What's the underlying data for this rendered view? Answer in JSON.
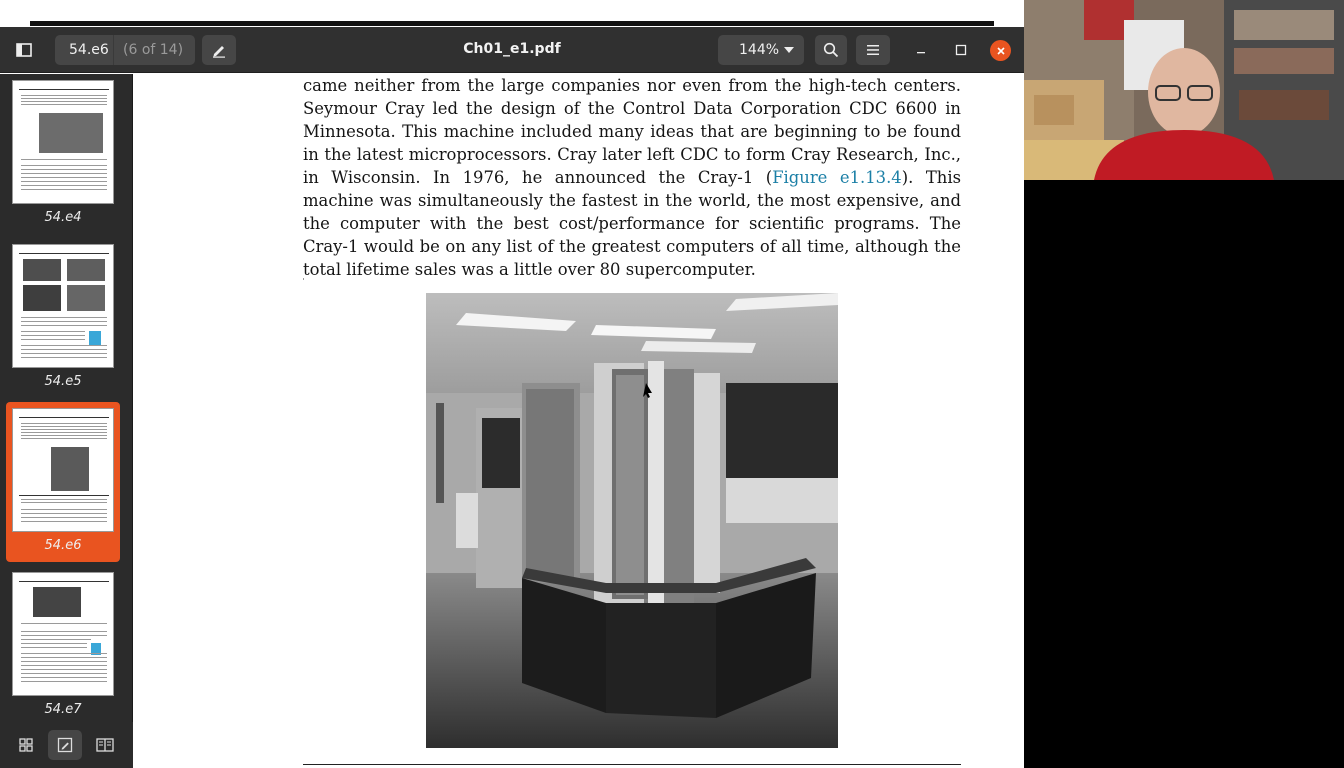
{
  "app": {
    "title": "Ch01_e1.pdf",
    "page_label": "54.e6",
    "page_of": "(6 of 14)",
    "zoom": "144%"
  },
  "icons": {
    "sidebar_toggle": "sidebar-icon",
    "annotate": "pencil-icon",
    "search": "search-icon",
    "menu": "hamburger-menu-icon",
    "minimize": "minimize-icon",
    "maximize": "maximize-icon",
    "close": "close-icon",
    "thumbnails": "grid-icon",
    "annotations": "annotations-icon",
    "bookmarks": "bookmarks-icon"
  },
  "colors": {
    "accent": "#e95420",
    "link": "#1b7fa6"
  },
  "thumbnails": [
    {
      "label": "54.e4",
      "selected": false
    },
    {
      "label": "54.e5",
      "selected": false
    },
    {
      "label": "54.e6",
      "selected": true
    },
    {
      "label": "54.e7",
      "selected": false
    }
  ],
  "document": {
    "text_before_link": "came neither from the large companies nor even from the high-tech centers. Seymour Cray led the design of the Control Data Corporation CDC 6600 in Minnesota. This machine included many ideas that are beginning to be found in the latest microprocessors. Cray later left CDC to form Cray Research, Inc., in Wisconsin. In 1976, he announced the Cray-1 (",
    "link_text": "Figure e1.13.4",
    "text_after_link": "). This machine was simultaneously the fastest in the world, the most expensive, and the computer with the best cost/performance for scientific programs. The Cray-1 would be on any list of the greatest computers of all time, although the total lifetime sales was a little over 80 supercomputer."
  }
}
